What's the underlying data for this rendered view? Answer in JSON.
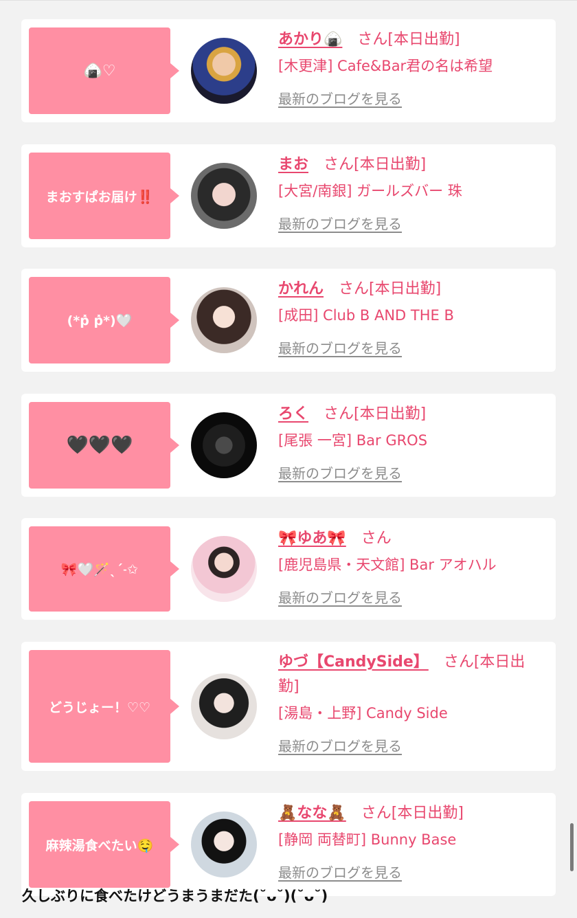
{
  "cards": [
    {
      "bubble": "🍙♡",
      "name": "あかり🍙",
      "suffix": "さん[本日出勤]",
      "shop": "[木更津] Cafe&Bar君の名は希望",
      "blog_link": "最新のブログを見る"
    },
    {
      "bubble": "まおすぱお届け‼️",
      "name": "まお",
      "suffix": "さん[本日出勤]",
      "shop": "[大宮/南銀] ガールズバー 珠",
      "blog_link": "最新のブログを見る"
    },
    {
      "bubble": "(*ṕ̀ ṕ̀*)🤍",
      "name": "かれん",
      "suffix": "さん[本日出勤]",
      "shop": "[成田] Club B AND THE B",
      "blog_link": "最新のブログを見る"
    },
    {
      "bubble": "🖤🖤🖤",
      "name": "ろく",
      "suffix": "さん[本日出勤]",
      "shop": "[尾張 一宮] Bar GROS",
      "blog_link": "最新のブログを見る"
    },
    {
      "bubble": "🎀🤍🪄ˎˊ˗✩",
      "name": "🎀ゆあ🎀",
      "suffix": "さん",
      "shop": "[鹿児島県・天文館] Bar アオハル",
      "blog_link": "最新のブログを見る"
    },
    {
      "bubble": "どうじょー！♡♡",
      "name": "ゆづ【CandySide】",
      "suffix": "さん[本日出勤]",
      "shop": "[湯島・上野] Candy Side",
      "blog_link": "最新のブログを見る"
    },
    {
      "bubble": "麻辣湯食べたい🤤",
      "name": "🧸なな🧸",
      "suffix": "さん[本日出勤]",
      "shop": "[静岡 両替町] Bunny Base",
      "blog_link": "最新のブログを見る"
    }
  ],
  "caption": "久しぶりに食べたけどうまうまだた(˘ᴗ˘)(˘ᴗ˘)"
}
